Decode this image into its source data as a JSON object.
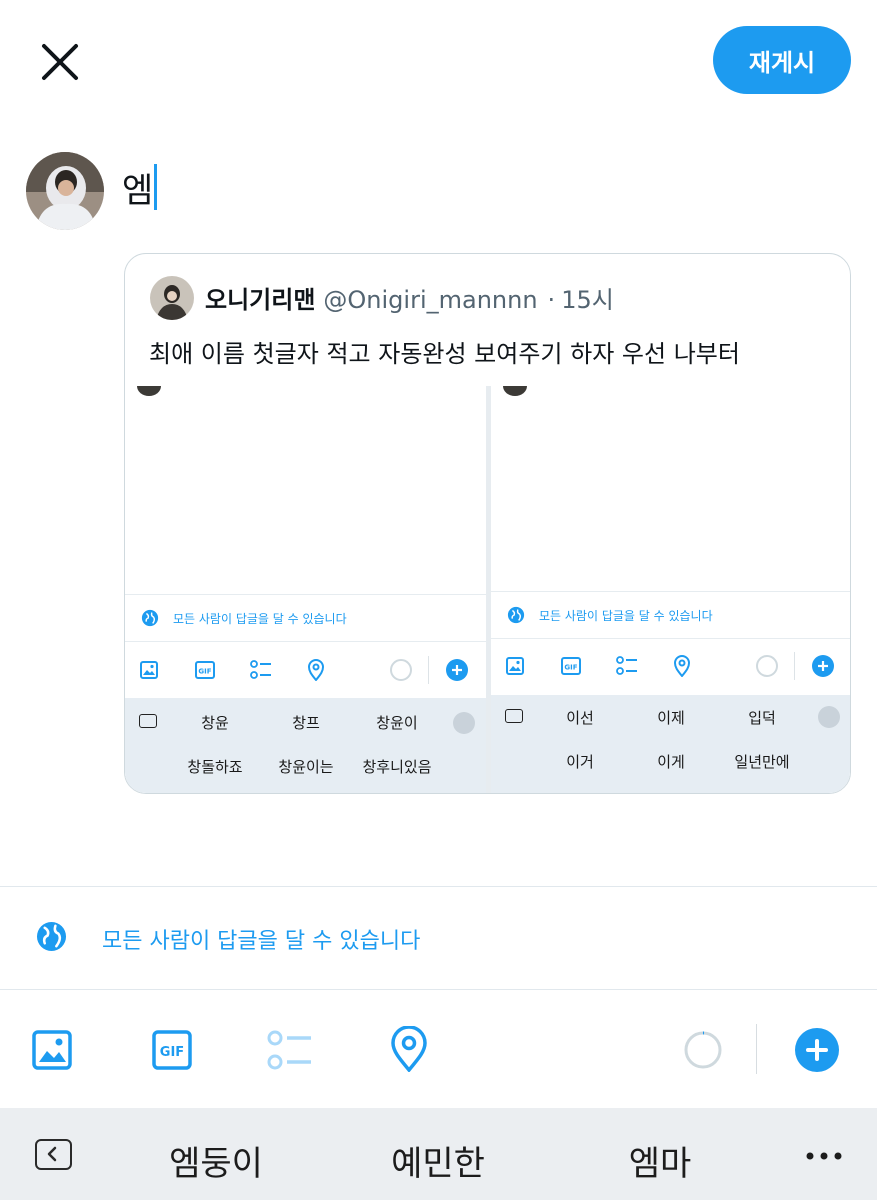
{
  "header": {
    "repost_label": "재게시"
  },
  "compose": {
    "text": "엠"
  },
  "quote": {
    "name": "오니기리맨",
    "handle": "@Onigiri_mannnn",
    "dot": "·",
    "time": "15시",
    "text": "최애 이름 첫글자 적고 자동완성 보여주기 하자 우선 나부터",
    "screenshots": [
      {
        "reply_setting": "모든 사람이 답글을 달 수 있습니다",
        "suggestions_row1": [
          "창윤",
          "창프",
          "창윤이"
        ],
        "suggestions_row2": [
          "창돌하죠",
          "창윤이는",
          "창후니있음"
        ]
      },
      {
        "reply_setting": "모든 사람이 답글을 달 수 있습니다",
        "suggestions_row1": [
          "이선",
          "이제",
          "입덕"
        ],
        "suggestions_row2": [
          "이거",
          "이게",
          "일년만에"
        ]
      }
    ]
  },
  "reply_setting": {
    "label": "모든 사람이 답글을 달 수 있습니다"
  },
  "toolbar": {
    "icons": [
      "image-icon",
      "gif-icon",
      "poll-icon",
      "location-icon",
      "char-count-circle",
      "add-thread-icon"
    ]
  },
  "suggestions": {
    "words": [
      "엠둥이",
      "예민한",
      "엠마"
    ]
  },
  "colors": {
    "accent": "#1d9bf0",
    "text": "#0f1419",
    "muted": "#536471",
    "keyboard": "#ebeef1"
  }
}
